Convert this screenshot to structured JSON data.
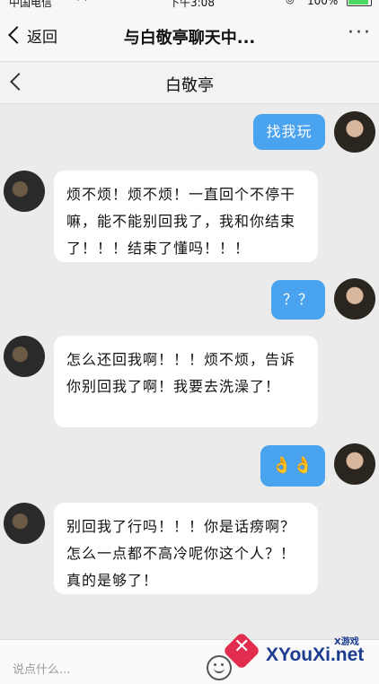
{
  "status_bar": {
    "carrier": "中国电信",
    "time": "下午3:08",
    "battery_percent": "100%"
  },
  "nav": {
    "back_label": "返回",
    "title": "与白敬亭聊天中...",
    "more_label": "···"
  },
  "chat": {
    "contact_name": "白敬亭",
    "messages": [
      {
        "sender": "me",
        "text": "找我玩"
      },
      {
        "sender": "other",
        "text": "烦不烦！烦不烦！一直回个不停干嘛，能不能别回我了，我和你结束了！！！结束了懂吗！！！"
      },
      {
        "sender": "me",
        "text": "？？"
      },
      {
        "sender": "other",
        "text": "怎么还回我啊！！！烦不烦，告诉你别回我了啊！我要去洗澡了！"
      },
      {
        "sender": "me",
        "text": "👌👌"
      },
      {
        "sender": "other",
        "text": "别回我了行吗！！！你是话痨啊？怎么一点都不高冷呢你这个人？！真的是够了！"
      }
    ]
  },
  "input": {
    "placeholder": "说点什么..."
  },
  "watermark": {
    "brand": "XYouXi.net",
    "tag": "X游戏"
  }
}
